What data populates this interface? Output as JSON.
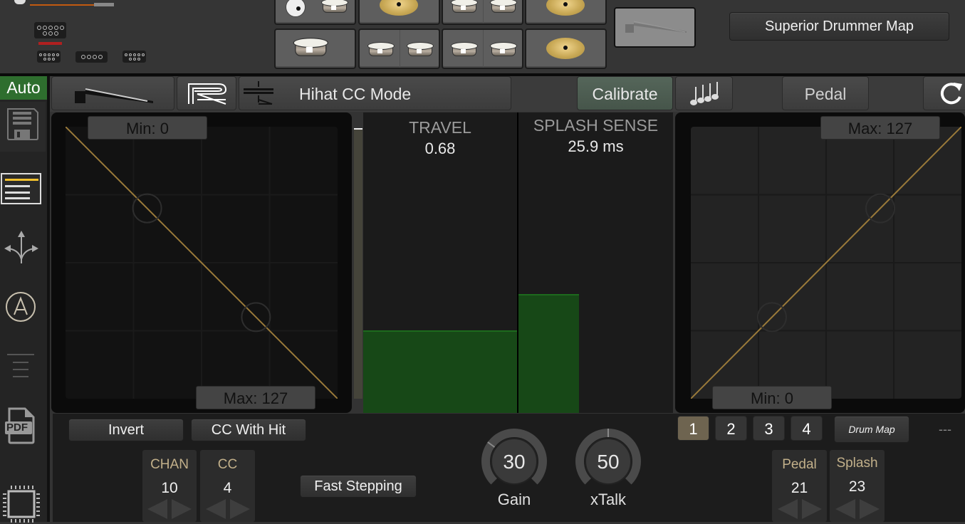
{
  "top": {
    "map_button": "Superior Drummer Map",
    "pads": [
      {
        "row": 1,
        "items": [
          "kick-drum",
          "tom-drum"
        ]
      },
      {
        "row": 1,
        "items": [
          "cymbal"
        ]
      },
      {
        "row": 1,
        "items": [
          "tom-drum",
          "tom-drum"
        ]
      },
      {
        "row": 1,
        "items": [
          "cymbal"
        ]
      },
      {
        "row": 2,
        "items": [
          "snare-drum"
        ]
      },
      {
        "row": 2,
        "items": [
          "tom-drum",
          "tom-drum"
        ]
      },
      {
        "row": 2,
        "items": [
          "tom-drum",
          "tom-drum"
        ]
      },
      {
        "row": 2,
        "items": [
          "cymbal"
        ]
      }
    ],
    "selected_pad": "hihat-pedal"
  },
  "sidebar": {
    "auto_label": "Auto",
    "items": [
      {
        "name": "save",
        "icon": "floppy-disk-icon"
      },
      {
        "name": "menu",
        "icon": "list-menu-icon",
        "active": true
      },
      {
        "name": "routing",
        "icon": "split-arrows-icon"
      },
      {
        "name": "auto-mode",
        "icon": "circle-a-icon"
      },
      {
        "name": "lines",
        "icon": "lines-icon"
      },
      {
        "name": "pdf",
        "icon": "pdf-file-icon",
        "label": "PDF"
      },
      {
        "name": "chip",
        "icon": "chip-icon"
      }
    ]
  },
  "toolbar": {
    "mode_label": "Hihat CC Mode",
    "calibrate_label": "Calibrate",
    "pedal_label": "Pedal",
    "accent_color": "#4d5e4d"
  },
  "left_curve": {
    "min_label": "Min: 0",
    "max_label": "Max: 127",
    "direction": "inverted"
  },
  "right_curve": {
    "min_label": "Min: 0",
    "max_label": "Max: 127",
    "direction": "linear"
  },
  "meters": {
    "travel": {
      "label": "TRAVEL",
      "value": "0.68",
      "fill": 0.27
    },
    "splash": {
      "label": "SPLASH SENSE",
      "value": "25.9 ms",
      "fill": 0.39
    }
  },
  "bottom": {
    "invert_label": "Invert",
    "cc_with_hit_label": "CC With Hit",
    "fast_stepping_label": "Fast Stepping",
    "chan": {
      "label": "CHAN",
      "value": "10"
    },
    "cc": {
      "label": "CC",
      "value": "4"
    },
    "gain": {
      "label": "Gain",
      "value": "30"
    },
    "xtalk": {
      "label": "xTalk",
      "value": "50"
    },
    "layers": [
      "1",
      "2",
      "3",
      "4"
    ],
    "active_layer": "1",
    "drum_map_label": "Drum Map",
    "dash_label": "---",
    "pedal": {
      "label": "Pedal",
      "value": "21"
    },
    "splash": {
      "label": "Splash",
      "value": "23"
    }
  },
  "colors": {
    "curve": "#9a7a3a",
    "meter_fill": "#174817",
    "auto_green": "#2e6e2e"
  }
}
